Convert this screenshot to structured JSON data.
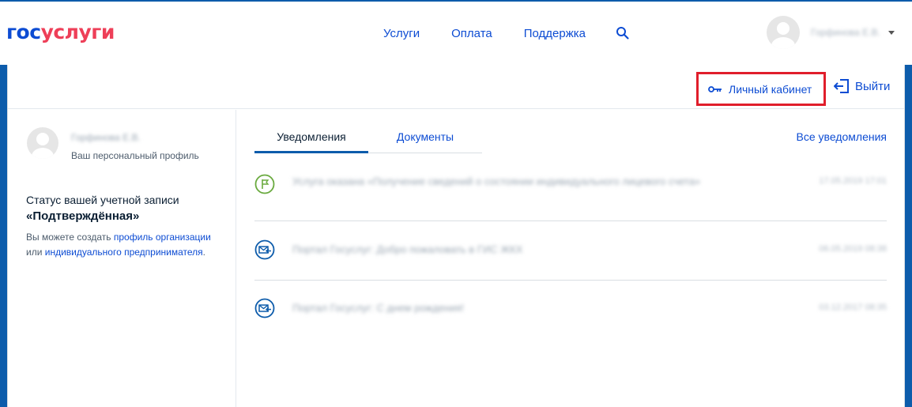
{
  "header": {
    "logo_part1": "гос",
    "logo_part2": "услуги",
    "nav": [
      "Услуги",
      "Оплата",
      "Поддержка"
    ],
    "user_name": "Горфинова Е.В."
  },
  "panel": {
    "personal_account_label": "Личный кабинет",
    "logout_label": "Выйти"
  },
  "sidebar": {
    "profile_name": "Горфинова Е.В.",
    "profile_subtitle": "Ваш персональный профиль",
    "status_label": "Статус вашей учетной записи",
    "status_value": "«Подтверждённая»",
    "hint_prefix": "Вы можете создать ",
    "hint_link1": "профиль организации",
    "hint_middle": "или ",
    "hint_link2": "индивидуального предпринимателя",
    "hint_suffix": "."
  },
  "main": {
    "tabs": [
      "Уведомления",
      "Документы"
    ],
    "all_notifications_label": "Все уведомления",
    "notifications": [
      {
        "icon": "flag-icon",
        "text": "Услуга оказана «Получение сведений о состоянии индивидуального лицевого счета»",
        "date": "17.05.2019 17:01"
      },
      {
        "icon": "envelope-icon",
        "text": "Портал Госуслуг: Добро пожаловать в ГИС ЖКХ",
        "date": "06.05.2019 08:38"
      },
      {
        "icon": "envelope-icon",
        "text": "Портал Госуслуг: С днем рождения!",
        "date": "03.12.2017 08:35"
      }
    ]
  },
  "colors": {
    "brand_blue": "#0d4cd3",
    "brand_red": "#ee3f58",
    "frame_blue": "#0d5cab",
    "highlight_red": "#e01e2b",
    "flag_green": "#6aaa3f"
  }
}
